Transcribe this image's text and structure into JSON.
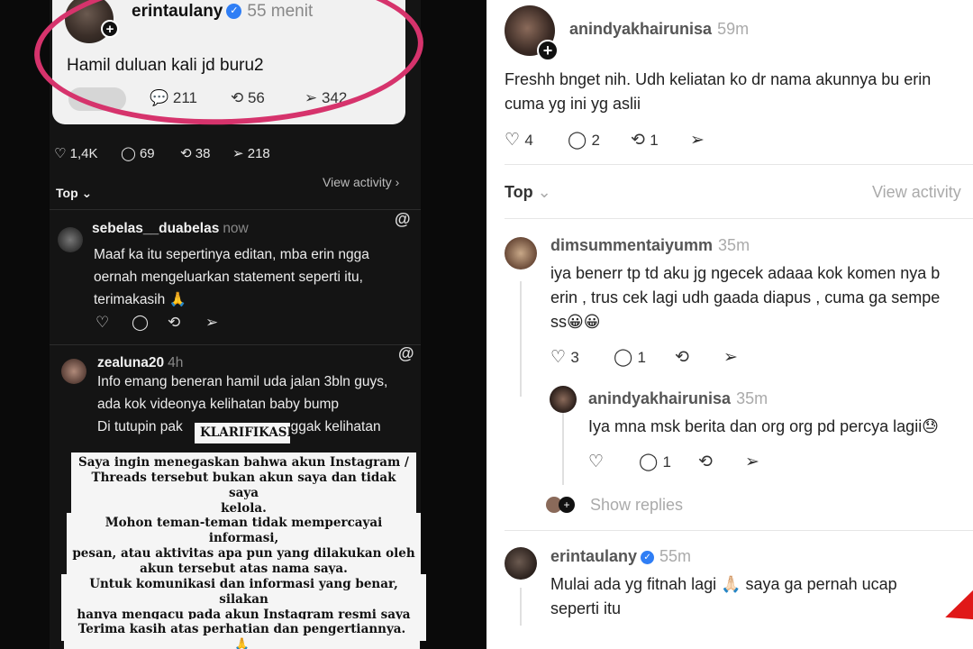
{
  "left": {
    "quote": {
      "username": "erintaulany",
      "time": "55 menit",
      "text": "Hamil duluan kali jd buru2",
      "comments": "211",
      "reposts": "56",
      "shares": "342"
    },
    "stats": {
      "likes": "1,4K",
      "comments": "69",
      "reposts": "38",
      "shares": "218"
    },
    "sort_label": "Top",
    "view_activity": "View activity",
    "comments": [
      {
        "username": "sebelas__duabelas",
        "time": "now",
        "lines": [
          "Maaf ka itu sepertinya editan, mba erin ngga",
          "oernah mengeluarkan statement seperti itu,",
          "terimakasih 🙏"
        ]
      },
      {
        "username": "zealuna20",
        "time": "4h",
        "lines": [
          "Info emang beneran hamil uda jalan 3bln guys,",
          "ada kok videonya kelihatan baby bump",
          "Di tutupin pak",
          "nggak kelihatan"
        ]
      }
    ],
    "klarifikasi": {
      "title": "KLARIFIKASI",
      "p1": [
        "Saya ingin menegaskan bahwa akun Instagram /",
        "Threads tersebut bukan akun saya dan tidak saya",
        "kelola."
      ],
      "p2": [
        "Mohon teman-teman tidak mempercayai informasi,",
        "pesan, atau aktivitas apa pun yang dilakukan oleh",
        "akun tersebut atas nama saya."
      ],
      "p3": [
        "Untuk komunikasi dan informasi yang benar, silakan",
        "hanya mengacu pada akun Instagram resmi saya ini"
      ],
      "p4": "Terima kasih atas perhatian dan pengertiannya. 🙏"
    }
  },
  "right": {
    "post": {
      "username": "anindyakhairunisa",
      "time": "59m",
      "lines": [
        "Freshh bnget nih. Udh keliatan ko dr nama akunnya bu erin",
        "cuma yg ini yg aslii"
      ],
      "likes": "4",
      "comments": "2",
      "reposts": "1"
    },
    "sort_label": "Top",
    "view_activity": "View activity",
    "reply1": {
      "username": "dimsummentaiyumm",
      "time": "35m",
      "lines": [
        "iya benerr tp td aku jg ngecek adaaa kok komen nya b",
        "erin , trus cek lagi udh gaada diapus , cuma ga sempe",
        "ss😀😀"
      ],
      "likes": "3",
      "comments": "1"
    },
    "reply2": {
      "username": "anindyakhairunisa",
      "time": "35m",
      "text": "Iya mna msk berita dan org org pd percya lagii😓",
      "comments": "1"
    },
    "show_replies": "Show replies",
    "reply3": {
      "username": "erintaulany",
      "time": "55m",
      "lines": [
        "Mulai ada yg fitnah lagi 🙏🏻 saya ga pernah ucap",
        "seperti itu"
      ]
    }
  }
}
